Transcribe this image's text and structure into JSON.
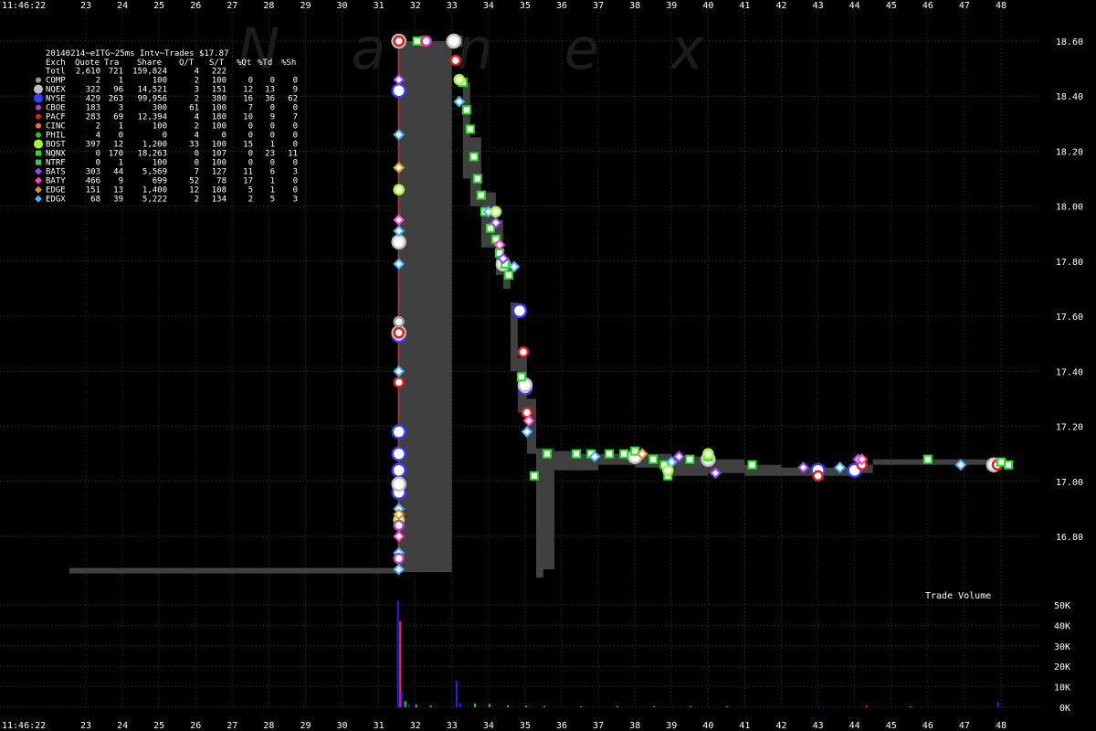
{
  "time_label_top": "11:46:22",
  "time_label_bottom": "11:46:22",
  "watermark": "Nanex",
  "volume_title": "Trade Volume",
  "colors": {
    "background": "#000000",
    "grid": "#3a3a3a",
    "nbbo": "#404040",
    "text": "#ffffff"
  },
  "table": {
    "title": "20140214~eITG~25ms Intv~Trades $17.87",
    "columns": [
      "Exch",
      "Quote",
      "Tra",
      "Share",
      "Q/T",
      "S/T",
      "%Qt",
      "%Td",
      "%Sh"
    ],
    "total": [
      "Totl",
      "2,610",
      "721",
      "159,824",
      "4",
      "222",
      "",
      "",
      ""
    ],
    "rows": [
      {
        "exch": "COMP",
        "quote": "2",
        "tra": "1",
        "share": "100",
        "qt": "2",
        "st": "100",
        "pqt": "0",
        "ptd": "0",
        "psh": "0",
        "color": "#9a9a9a",
        "marker": "circle"
      },
      {
        "exch": "NQEX",
        "quote": "322",
        "tra": "96",
        "share": "14,521",
        "qt": "3",
        "st": "151",
        "pqt": "12",
        "ptd": "13",
        "psh": "9",
        "color": "#c0c0c0",
        "marker": "circle"
      },
      {
        "exch": "NYSE",
        "quote": "429",
        "tra": "263",
        "share": "99,956",
        "qt": "2",
        "st": "380",
        "pqt": "16",
        "ptd": "36",
        "psh": "62",
        "color": "#3b3bff",
        "marker": "circle"
      },
      {
        "exch": "CBOE",
        "quote": "183",
        "tra": "3",
        "share": "300",
        "qt": "61",
        "st": "100",
        "pqt": "7",
        "ptd": "0",
        "psh": "0",
        "color": "#c040c0",
        "marker": "circle"
      },
      {
        "exch": "PACF",
        "quote": "283",
        "tra": "69",
        "share": "12,394",
        "qt": "4",
        "st": "180",
        "pqt": "10",
        "ptd": "9",
        "psh": "7",
        "color": "#e02020",
        "marker": "circle"
      },
      {
        "exch": "CINC",
        "quote": "2",
        "tra": "1",
        "share": "100",
        "qt": "2",
        "st": "100",
        "pqt": "0",
        "ptd": "0",
        "psh": "0",
        "color": "#e08020",
        "marker": "circle"
      },
      {
        "exch": "PHIL",
        "quote": "4",
        "tra": "0",
        "share": "0",
        "qt": "4",
        "st": "0",
        "pqt": "0",
        "ptd": "0",
        "psh": "0",
        "color": "#30c030",
        "marker": "circle"
      },
      {
        "exch": "BOST",
        "quote": "397",
        "tra": "12",
        "share": "1,200",
        "qt": "33",
        "st": "100",
        "pqt": "15",
        "ptd": "1",
        "psh": "0",
        "color": "#a0ff30",
        "marker": "circle"
      },
      {
        "exch": "NQNX",
        "quote": "0",
        "tra": "170",
        "share": "18,263",
        "qt": "0",
        "st": "107",
        "pqt": "0",
        "ptd": "23",
        "psh": "11",
        "color": "#20e020",
        "marker": "square"
      },
      {
        "exch": "NTRF",
        "quote": "0",
        "tra": "1",
        "share": "100",
        "qt": "0",
        "st": "100",
        "pqt": "0",
        "ptd": "0",
        "psh": "0",
        "color": "#20d060",
        "marker": "square"
      },
      {
        "exch": "BATS",
        "quote": "303",
        "tra": "44",
        "share": "5,569",
        "qt": "7",
        "st": "127",
        "pqt": "11",
        "ptd": "6",
        "psh": "3",
        "color": "#a040ff",
        "marker": "diamond"
      },
      {
        "exch": "BATY",
        "quote": "466",
        "tra": "9",
        "share": "699",
        "qt": "52",
        "st": "78",
        "pqt": "17",
        "ptd": "1",
        "psh": "0",
        "color": "#ff40c0",
        "marker": "diamond"
      },
      {
        "exch": "EDGE",
        "quote": "151",
        "tra": "13",
        "share": "1,400",
        "qt": "12",
        "st": "108",
        "pqt": "5",
        "ptd": "1",
        "psh": "0",
        "color": "#e09020",
        "marker": "diamond"
      },
      {
        "exch": "EDGX",
        "quote": "68",
        "tra": "39",
        "share": "5,222",
        "qt": "2",
        "st": "134",
        "pqt": "2",
        "ptd": "5",
        "psh": "3",
        "color": "#40b0ff",
        "marker": "diamond"
      }
    ]
  },
  "chart_data": {
    "type": "scatter",
    "x_ticks": [
      "23",
      "24",
      "25",
      "26",
      "27",
      "28",
      "29",
      "30",
      "31",
      "32",
      "33",
      "34",
      "35",
      "36",
      "37",
      "38",
      "39",
      "40",
      "41",
      "42",
      "43",
      "44",
      "45",
      "46",
      "47",
      "48"
    ],
    "xlim": [
      22.5,
      49.2
    ],
    "price_ticks": [
      "16.80",
      "17.00",
      "17.20",
      "17.40",
      "17.60",
      "17.80",
      "18.00",
      "18.20",
      "18.40",
      "18.60"
    ],
    "price_ylim": [
      16.6,
      18.66
    ],
    "volume_ticks": [
      "0K",
      "10K",
      "20K",
      "30K",
      "40K",
      "50K"
    ],
    "volume_ylim": [
      0,
      55000
    ],
    "nbbo_band": [
      [
        22.55,
        16.665,
        16.685
      ],
      [
        31.5,
        16.665,
        16.685
      ],
      [
        31.52,
        16.67,
        18.6
      ],
      [
        33.0,
        18.58,
        18.62
      ],
      [
        33.3,
        18.1,
        18.45
      ],
      [
        33.5,
        18.0,
        18.25
      ],
      [
        33.8,
        17.85,
        18.05
      ],
      [
        34.2,
        17.75,
        17.95
      ],
      [
        34.4,
        17.7,
        17.8
      ],
      [
        34.6,
        17.4,
        17.65
      ],
      [
        34.8,
        17.25,
        17.45
      ],
      [
        35.05,
        17.1,
        17.3
      ],
      [
        35.3,
        16.65,
        17.12
      ],
      [
        35.5,
        16.68,
        17.12
      ],
      [
        35.8,
        17.04,
        17.11
      ],
      [
        36.3,
        17.04,
        17.1
      ],
      [
        37.0,
        17.06,
        17.1
      ],
      [
        38.0,
        17.05,
        17.1
      ],
      [
        39.0,
        17.02,
        17.09
      ],
      [
        40.0,
        17.03,
        17.08
      ],
      [
        41.0,
        17.02,
        17.06
      ],
      [
        42.0,
        17.02,
        17.05
      ],
      [
        43.0,
        17.02,
        17.05
      ],
      [
        43.5,
        17.02,
        17.05
      ],
      [
        44.0,
        17.03,
        17.06
      ],
      [
        44.5,
        17.06,
        17.08
      ],
      [
        45.0,
        17.06,
        17.08
      ],
      [
        46.5,
        17.06,
        17.08
      ],
      [
        48.1,
        17.06,
        17.08
      ]
    ],
    "series": [
      {
        "name": "NYSE",
        "color": "#3b3bff",
        "points": [
          [
            31.55,
            18.6
          ],
          [
            31.55,
            18.42
          ],
          [
            31.55,
            17.53
          ],
          [
            31.55,
            17.18
          ],
          [
            31.55,
            17.1
          ],
          [
            31.55,
            17.04
          ],
          [
            31.55,
            16.96
          ],
          [
            33.05,
            18.6
          ],
          [
            34.85,
            17.62
          ],
          [
            35.0,
            17.34
          ],
          [
            43.0,
            17.04
          ],
          [
            44.0,
            17.04
          ]
        ]
      },
      {
        "name": "NQEX",
        "color": "#c0c0c0",
        "points": [
          [
            31.55,
            18.6
          ],
          [
            31.55,
            17.87
          ],
          [
            31.55,
            17.54
          ],
          [
            31.55,
            16.99
          ],
          [
            33.05,
            18.6
          ],
          [
            34.4,
            17.79
          ],
          [
            35.0,
            17.35
          ],
          [
            38.0,
            17.09
          ],
          [
            40.0,
            17.08
          ],
          [
            47.8,
            17.06
          ]
        ]
      },
      {
        "name": "PACF",
        "color": "#e02020",
        "points": [
          [
            31.55,
            18.6
          ],
          [
            31.55,
            17.54
          ],
          [
            31.55,
            17.36
          ],
          [
            32.2,
            18.6
          ],
          [
            33.1,
            18.53
          ],
          [
            34.95,
            17.47
          ],
          [
            35.05,
            17.25
          ],
          [
            43.0,
            17.02
          ],
          [
            44.2,
            17.06
          ],
          [
            47.9,
            17.06
          ]
        ]
      },
      {
        "name": "NQNX",
        "color": "#20e020",
        "points": [
          [
            32.05,
            18.6
          ],
          [
            33.3,
            18.45
          ],
          [
            33.4,
            18.35
          ],
          [
            33.5,
            18.28
          ],
          [
            33.6,
            18.18
          ],
          [
            33.7,
            18.1
          ],
          [
            33.8,
            18.04
          ],
          [
            33.9,
            17.98
          ],
          [
            34.05,
            17.92
          ],
          [
            34.2,
            17.88
          ],
          [
            34.3,
            17.83
          ],
          [
            34.45,
            17.79
          ],
          [
            34.55,
            17.75
          ],
          [
            34.9,
            17.38
          ],
          [
            35.25,
            17.02
          ],
          [
            35.6,
            17.1
          ],
          [
            36.4,
            17.1
          ],
          [
            36.8,
            17.1
          ],
          [
            37.3,
            17.1
          ],
          [
            37.7,
            17.1
          ],
          [
            38.0,
            17.11
          ],
          [
            38.5,
            17.08
          ],
          [
            38.8,
            17.06
          ],
          [
            38.9,
            17.02
          ],
          [
            39.5,
            17.08
          ],
          [
            40.0,
            17.09
          ],
          [
            41.2,
            17.06
          ],
          [
            46.0,
            17.08
          ],
          [
            48.0,
            17.07
          ],
          [
            48.2,
            17.06
          ]
        ]
      },
      {
        "name": "BATS",
        "color": "#a040ff",
        "points": [
          [
            31.55,
            18.46
          ],
          [
            34.2,
            17.94
          ],
          [
            34.4,
            17.81
          ],
          [
            39.2,
            17.09
          ],
          [
            40.2,
            17.03
          ],
          [
            42.6,
            17.05
          ],
          [
            44.1,
            17.08
          ]
        ]
      },
      {
        "name": "EDGX",
        "color": "#40b0ff",
        "points": [
          [
            31.55,
            18.26
          ],
          [
            31.55,
            18.14
          ],
          [
            31.55,
            17.91
          ],
          [
            31.55,
            17.79
          ],
          [
            31.55,
            17.4
          ],
          [
            31.55,
            16.9
          ],
          [
            31.55,
            16.74
          ],
          [
            31.55,
            16.68
          ],
          [
            33.2,
            18.38
          ],
          [
            34.0,
            17.98
          ],
          [
            34.7,
            17.78
          ],
          [
            35.05,
            17.18
          ],
          [
            36.9,
            17.09
          ],
          [
            39.0,
            17.07
          ],
          [
            43.6,
            17.05
          ],
          [
            46.9,
            17.06
          ]
        ]
      },
      {
        "name": "BOST",
        "color": "#a0ff30",
        "points": [
          [
            31.55,
            18.06
          ],
          [
            31.55,
            16.86
          ],
          [
            33.2,
            18.46
          ],
          [
            34.2,
            17.98
          ],
          [
            38.9,
            17.04
          ],
          [
            40.0,
            17.1
          ]
        ]
      },
      {
        "name": "BATY",
        "color": "#ff40c0",
        "points": [
          [
            31.55,
            17.95
          ],
          [
            31.55,
            16.8
          ],
          [
            34.3,
            17.86
          ],
          [
            35.1,
            17.22
          ],
          [
            44.2,
            17.08
          ]
        ]
      },
      {
        "name": "EDGE",
        "color": "#e09020",
        "points": [
          [
            31.55,
            18.14
          ],
          [
            31.55,
            16.88
          ],
          [
            38.2,
            17.1
          ]
        ]
      },
      {
        "name": "CBOE",
        "color": "#c040c0",
        "points": [
          [
            31.55,
            16.84
          ],
          [
            31.55,
            16.72
          ],
          [
            32.3,
            18.6
          ]
        ]
      },
      {
        "name": "COMP",
        "color": "#9a9a9a",
        "points": [
          [
            31.55,
            17.58
          ]
        ]
      }
    ],
    "volume": [
      {
        "x": 31.5,
        "v": 52000,
        "color": "#2020ff"
      },
      {
        "x": 31.56,
        "v": 42000,
        "color": "#ff2020"
      },
      {
        "x": 31.6,
        "v": 8000,
        "color": "#2020ff"
      },
      {
        "x": 31.7,
        "v": 3000,
        "color": "#20e020"
      },
      {
        "x": 31.8,
        "v": 1500,
        "color": "#2020ff"
      },
      {
        "x": 32.0,
        "v": 1200,
        "color": "#20e020"
      },
      {
        "x": 32.4,
        "v": 800,
        "color": "#20e020"
      },
      {
        "x": 33.1,
        "v": 13000,
        "color": "#2020ff"
      },
      {
        "x": 33.2,
        "v": 2000,
        "color": "#2020ff"
      },
      {
        "x": 33.6,
        "v": 1800,
        "color": "#20e020"
      },
      {
        "x": 34.0,
        "v": 1500,
        "color": "#20e020"
      },
      {
        "x": 34.5,
        "v": 900,
        "color": "#20e020"
      },
      {
        "x": 35.0,
        "v": 700,
        "color": "#20e020"
      },
      {
        "x": 35.5,
        "v": 600,
        "color": "#20e020"
      },
      {
        "x": 36.5,
        "v": 500,
        "color": "#20e020"
      },
      {
        "x": 37.5,
        "v": 600,
        "color": "#20e020"
      },
      {
        "x": 38.5,
        "v": 500,
        "color": "#20e020"
      },
      {
        "x": 39.5,
        "v": 500,
        "color": "#20e020"
      },
      {
        "x": 40.5,
        "v": 500,
        "color": "#20e020"
      },
      {
        "x": 43.0,
        "v": 400,
        "color": "#2020ff"
      },
      {
        "x": 44.3,
        "v": 800,
        "color": "#ff2020"
      },
      {
        "x": 45.5,
        "v": 400,
        "color": "#20e020"
      },
      {
        "x": 47.9,
        "v": 2500,
        "color": "#2020ff"
      }
    ]
  }
}
